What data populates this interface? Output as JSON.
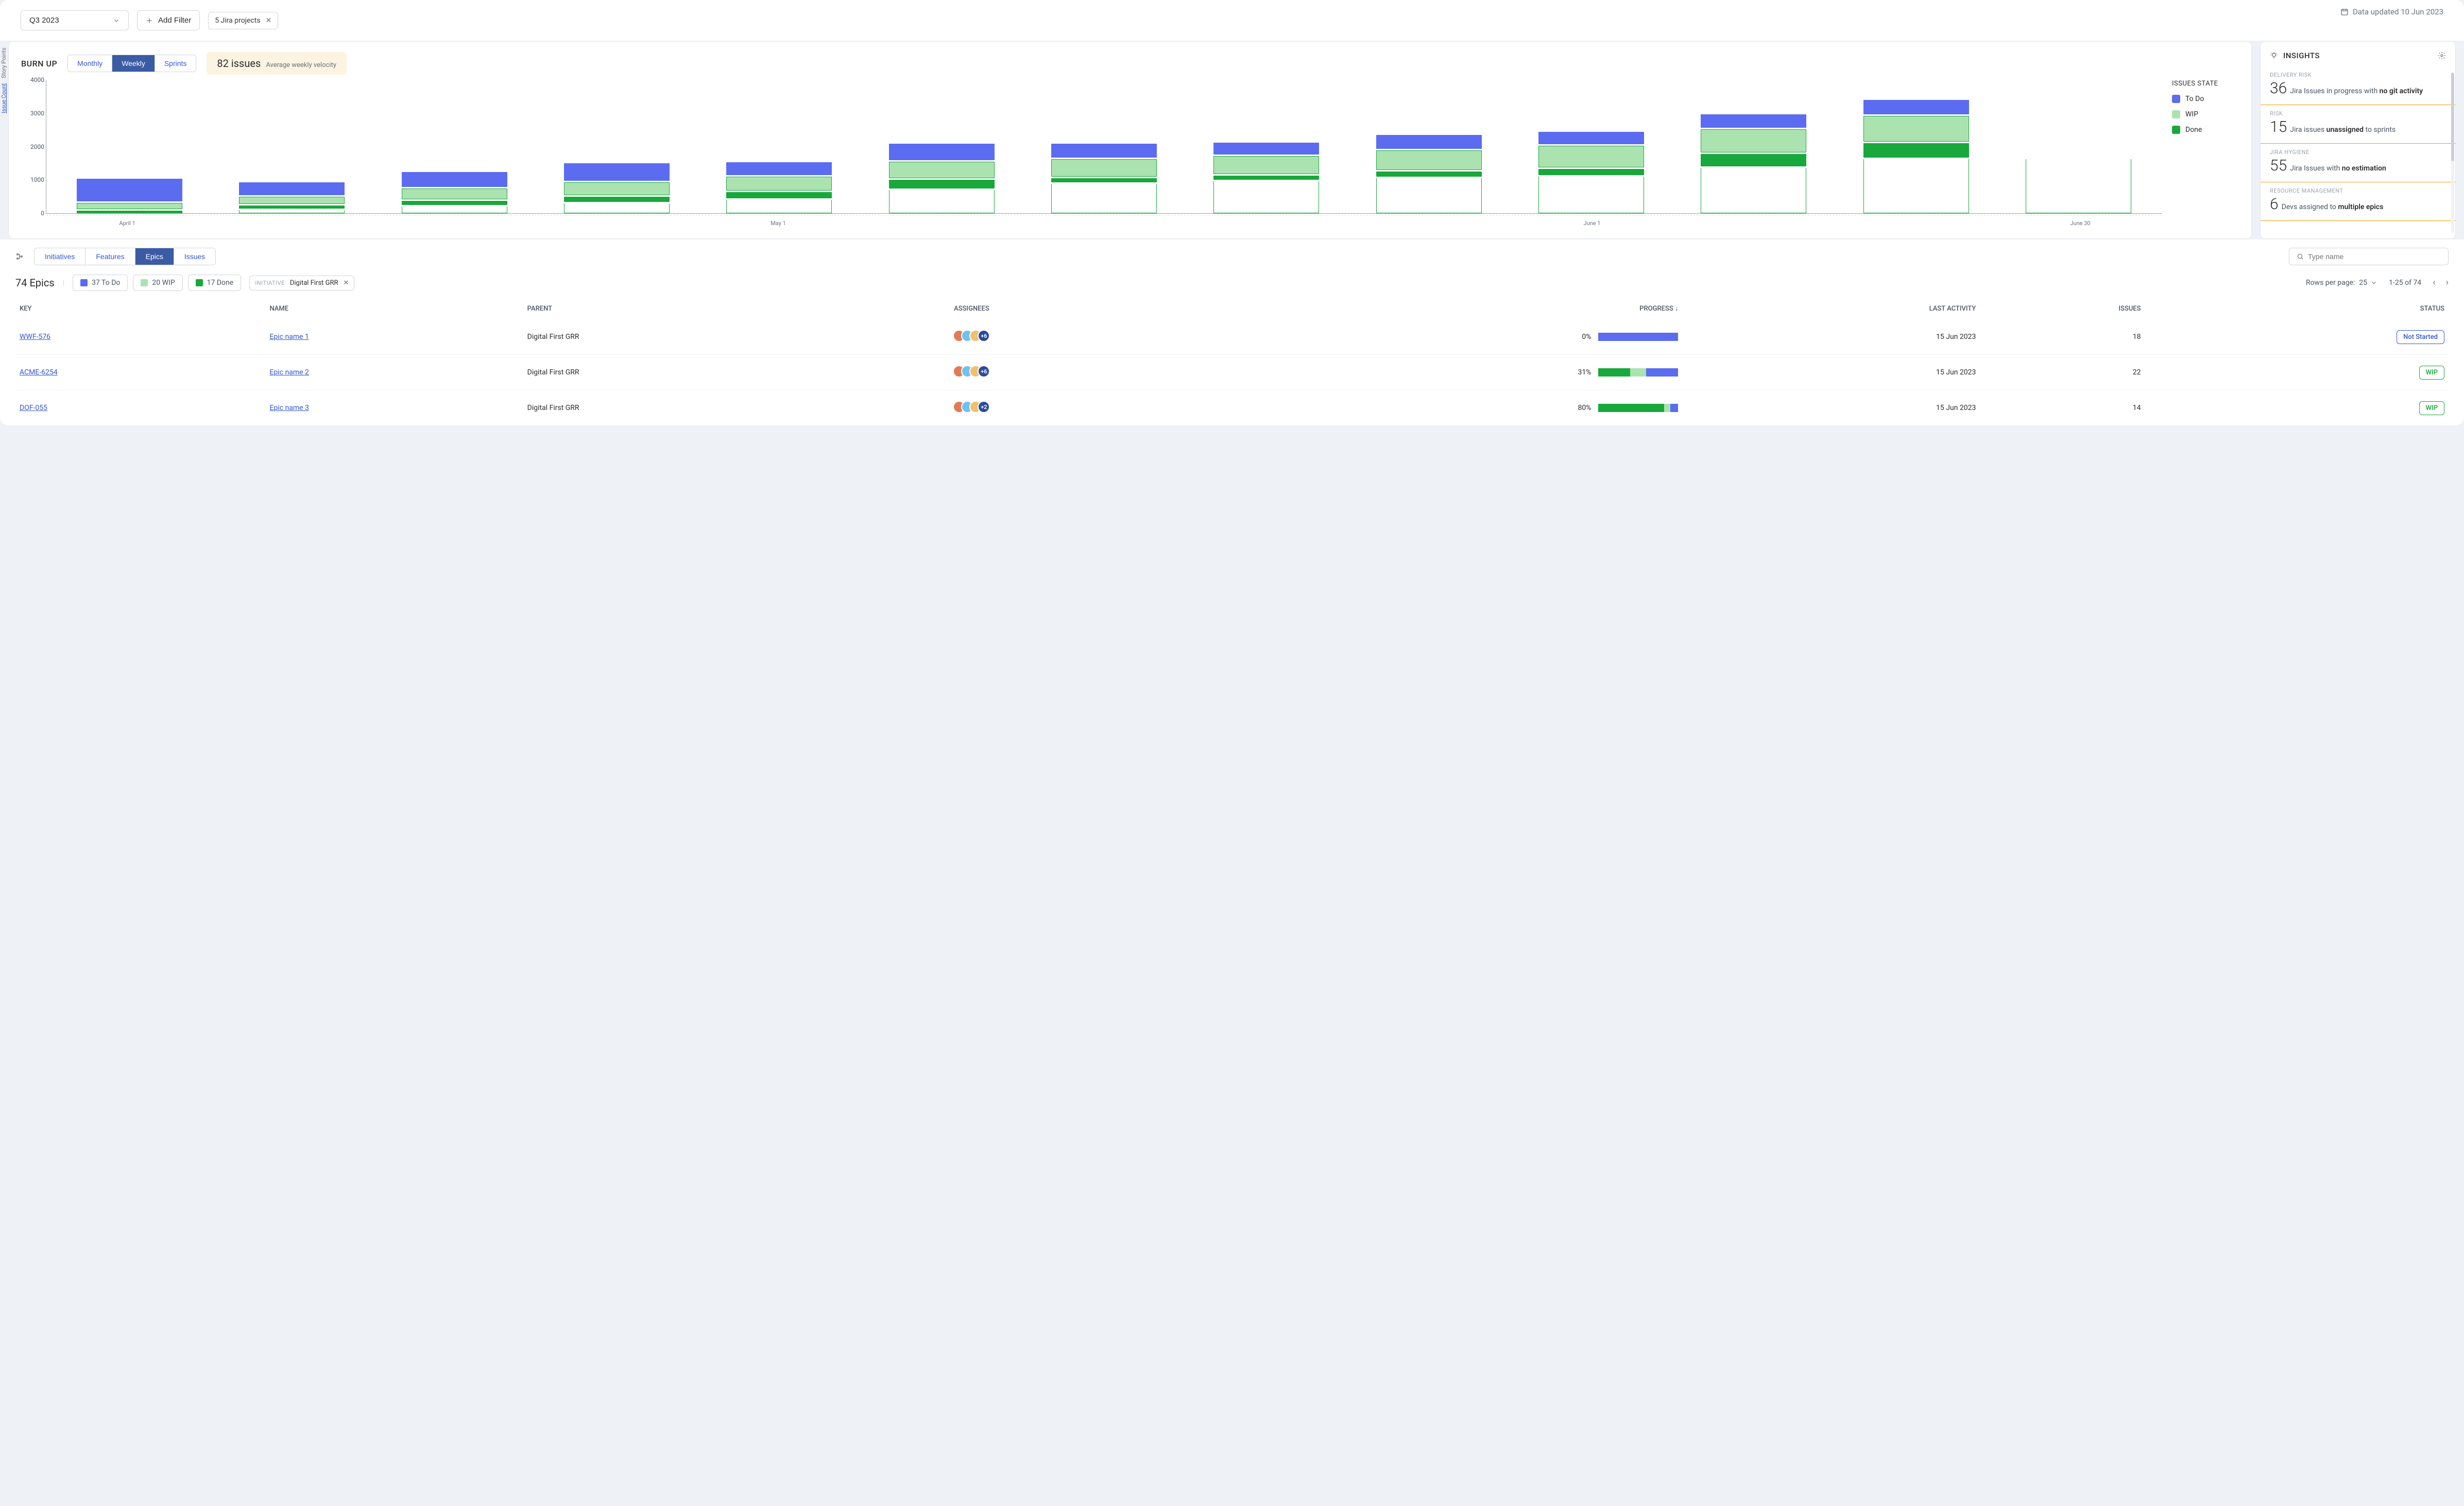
{
  "updated_label": "Data updated 10 Jun 2023",
  "filters": {
    "period": "Q3 2023",
    "add_filter_label": "Add Filter",
    "project_chip": "5 Jira projects"
  },
  "chart": {
    "title": "BURN UP",
    "segments": [
      "Monthly",
      "Weekly",
      "Sprints"
    ],
    "active_segment": "Weekly",
    "velocity_value": "82 issues",
    "velocity_label": "Average weekly velocity",
    "legend_title": "ISSUES STATE",
    "legend": [
      {
        "key": "todo",
        "label": "To Do"
      },
      {
        "key": "wip",
        "label": "WIP"
      },
      {
        "key": "done",
        "label": "Done"
      }
    ],
    "y_axis_primary": "Story Points",
    "y_axis_secondary": "Issue Count"
  },
  "chart_data": {
    "type": "bar",
    "stacked": true,
    "ylabel": "Story Points",
    "ylim": [
      0,
      4000
    ],
    "yticks": [
      0,
      1000,
      2000,
      3000,
      4000
    ],
    "x_categories": [
      "April 1",
      "",
      "",
      "",
      "May 1",
      "",
      "",
      "",
      "",
      "June 1",
      "",
      "",
      "June 30"
    ],
    "series_order": [
      "done_prev",
      "done",
      "wip",
      "todo"
    ],
    "series": {
      "done_prev": {
        "label": "Done (cumulative base)",
        "style": "blank",
        "values": [
          0,
          100,
          200,
          300,
          400,
          700,
          880,
          950,
          1050,
          1100,
          1350,
          1620,
          1620
        ]
      },
      "done": {
        "label": "Done",
        "values": [
          80,
          80,
          120,
          150,
          180,
          260,
          120,
          120,
          150,
          180,
          380,
          430,
          0
        ]
      },
      "wip": {
        "label": "WIP",
        "values": [
          180,
          220,
          320,
          380,
          420,
          480,
          520,
          540,
          580,
          640,
          680,
          760,
          0
        ]
      },
      "todo": {
        "label": "To Do",
        "values": [
          680,
          380,
          460,
          520,
          380,
          500,
          420,
          360,
          420,
          380,
          400,
          440,
          0
        ]
      }
    },
    "x_ticks_shown": {
      "0": "April 1",
      "4": "May 1",
      "9": "June 1",
      "12": "June 30"
    }
  },
  "insights": {
    "title": "INSIGHTS",
    "items": [
      {
        "cat": "DELIVERY RISK",
        "num": "36",
        "pre": "Jira Issues in progress with ",
        "bold": "no git activity",
        "post": ""
      },
      {
        "cat": "RISK",
        "num": "15",
        "pre": "Jira issues ",
        "bold": "unassigned",
        "post": " to sprints"
      },
      {
        "cat": "JIRA HYGIENE",
        "num": "55",
        "pre": "Jira Issues with ",
        "bold": "no estimation",
        "post": ""
      },
      {
        "cat": "RESOURCE MANAGEMENT",
        "num": "6",
        "pre": "Devs assigned to ",
        "bold": "multiple epics",
        "post": ""
      }
    ]
  },
  "table": {
    "tabs": [
      "Initiatives",
      "Features",
      "Epics",
      "Issues"
    ],
    "active_tab": "Epics",
    "search_placeholder": "Type name",
    "total_label": "74 Epics",
    "status_counts": [
      {
        "key": "todo",
        "label": "37 To Do",
        "color": "#5b6cf0"
      },
      {
        "key": "wip",
        "label": "20 WIP",
        "color": "#abe3b0"
      },
      {
        "key": "done",
        "label": "17 Done",
        "color": "#18a83b"
      }
    ],
    "initiative_filter": {
      "label": "INITIATIVE",
      "value": "Digital First GRR"
    },
    "pager": {
      "rows_label": "Rows per page:",
      "rows_value": "25",
      "range": "1-25 of 74"
    },
    "columns": [
      "KEY",
      "NAME",
      "PARENT",
      "ASSIGNEES",
      "PROGRESS",
      "LAST ACTIVITY",
      "ISSUES",
      "STATUS"
    ],
    "sort_desc_col": "PROGRESS",
    "rows": [
      {
        "key": "WWF-576",
        "name": "Epic name 1",
        "parent": "Digital First GRR",
        "assignees_extra": "+6",
        "progress_pct": "0%",
        "progress": {
          "done": 0,
          "wip": 0,
          "todo": 100
        },
        "last": "15 Jun 2023",
        "issues": "18",
        "status": "Not Started",
        "status_class": "notstarted"
      },
      {
        "key": "ACME-6254",
        "name": "Epic name 2",
        "parent": "Digital First GRR",
        "assignees_extra": "+6",
        "progress_pct": "31%",
        "progress": {
          "done": 40,
          "wip": 20,
          "todo": 40
        },
        "last": "15 Jun 2023",
        "issues": "22",
        "status": "WIP",
        "status_class": "wip"
      },
      {
        "key": "DOF-055",
        "name": "Epic name 3",
        "parent": "Digital First GRR",
        "assignees_extra": "+2",
        "progress_pct": "80%",
        "progress": {
          "done": 82,
          "wip": 8,
          "todo": 10
        },
        "last": "15 Jun 2023",
        "issues": "14",
        "status": "WIP",
        "status_class": "wip"
      }
    ],
    "avatar_colors": [
      "#e07b55",
      "#6ec2f0",
      "#f0c06e"
    ]
  }
}
